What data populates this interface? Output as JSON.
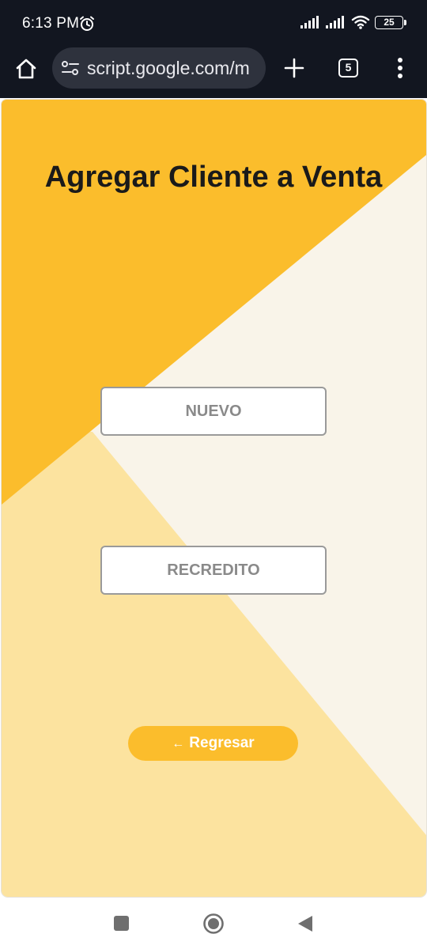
{
  "status_bar": {
    "time": "6:13 PM",
    "battery": "25",
    "icons": [
      "alarm-icon",
      "signal-icon",
      "signal-icon",
      "wifi-icon",
      "battery-icon"
    ]
  },
  "browser": {
    "url": "script.google.com/m",
    "tab_count": "5",
    "icons": [
      "home-icon",
      "site-settings-icon",
      "plus-icon",
      "more-vert-icon"
    ]
  },
  "page": {
    "title": "Agregar Cliente a Venta",
    "buttons": {
      "nuevo": "NUEVO",
      "recredito": "RECREDITO",
      "back_arrow": "←",
      "back_label": "Regresar"
    },
    "colors": {
      "accent": "#fbbd2c",
      "background_light": "#f9f4e9",
      "background_mid": "#fce39f"
    }
  },
  "nav_bar": {
    "icons": [
      "recents-square-icon",
      "home-circle-icon",
      "back-triangle-icon"
    ]
  }
}
